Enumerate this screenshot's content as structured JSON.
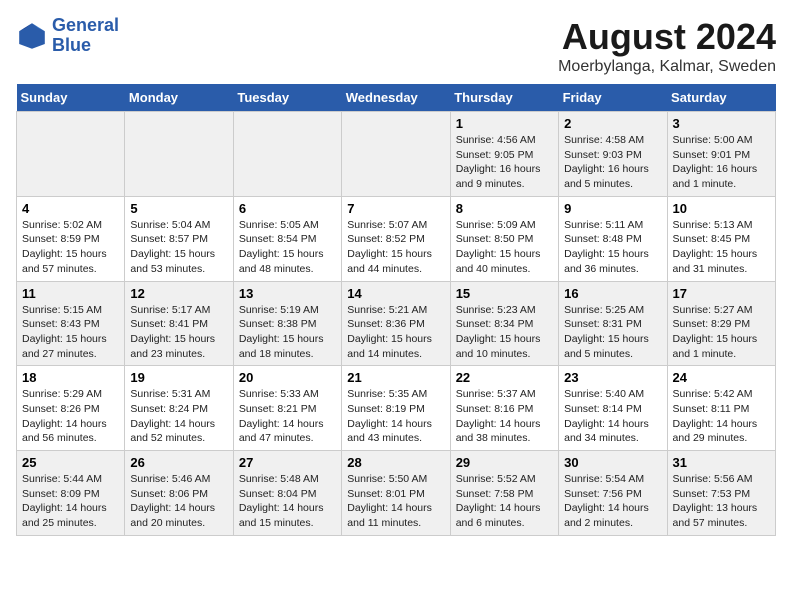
{
  "logo": {
    "text_general": "General",
    "text_blue": "Blue"
  },
  "title": "August 2024",
  "subtitle": "Moerbylanga, Kalmar, Sweden",
  "days_of_week": [
    "Sunday",
    "Monday",
    "Tuesday",
    "Wednesday",
    "Thursday",
    "Friday",
    "Saturday"
  ],
  "weeks": [
    [
      {
        "day": "",
        "info": ""
      },
      {
        "day": "",
        "info": ""
      },
      {
        "day": "",
        "info": ""
      },
      {
        "day": "",
        "info": ""
      },
      {
        "day": "1",
        "info": "Sunrise: 4:56 AM\nSunset: 9:05 PM\nDaylight: 16 hours\nand 9 minutes."
      },
      {
        "day": "2",
        "info": "Sunrise: 4:58 AM\nSunset: 9:03 PM\nDaylight: 16 hours\nand 5 minutes."
      },
      {
        "day": "3",
        "info": "Sunrise: 5:00 AM\nSunset: 9:01 PM\nDaylight: 16 hours\nand 1 minute."
      }
    ],
    [
      {
        "day": "4",
        "info": "Sunrise: 5:02 AM\nSunset: 8:59 PM\nDaylight: 15 hours\nand 57 minutes."
      },
      {
        "day": "5",
        "info": "Sunrise: 5:04 AM\nSunset: 8:57 PM\nDaylight: 15 hours\nand 53 minutes."
      },
      {
        "day": "6",
        "info": "Sunrise: 5:05 AM\nSunset: 8:54 PM\nDaylight: 15 hours\nand 48 minutes."
      },
      {
        "day": "7",
        "info": "Sunrise: 5:07 AM\nSunset: 8:52 PM\nDaylight: 15 hours\nand 44 minutes."
      },
      {
        "day": "8",
        "info": "Sunrise: 5:09 AM\nSunset: 8:50 PM\nDaylight: 15 hours\nand 40 minutes."
      },
      {
        "day": "9",
        "info": "Sunrise: 5:11 AM\nSunset: 8:48 PM\nDaylight: 15 hours\nand 36 minutes."
      },
      {
        "day": "10",
        "info": "Sunrise: 5:13 AM\nSunset: 8:45 PM\nDaylight: 15 hours\nand 31 minutes."
      }
    ],
    [
      {
        "day": "11",
        "info": "Sunrise: 5:15 AM\nSunset: 8:43 PM\nDaylight: 15 hours\nand 27 minutes."
      },
      {
        "day": "12",
        "info": "Sunrise: 5:17 AM\nSunset: 8:41 PM\nDaylight: 15 hours\nand 23 minutes."
      },
      {
        "day": "13",
        "info": "Sunrise: 5:19 AM\nSunset: 8:38 PM\nDaylight: 15 hours\nand 18 minutes."
      },
      {
        "day": "14",
        "info": "Sunrise: 5:21 AM\nSunset: 8:36 PM\nDaylight: 15 hours\nand 14 minutes."
      },
      {
        "day": "15",
        "info": "Sunrise: 5:23 AM\nSunset: 8:34 PM\nDaylight: 15 hours\nand 10 minutes."
      },
      {
        "day": "16",
        "info": "Sunrise: 5:25 AM\nSunset: 8:31 PM\nDaylight: 15 hours\nand 5 minutes."
      },
      {
        "day": "17",
        "info": "Sunrise: 5:27 AM\nSunset: 8:29 PM\nDaylight: 15 hours\nand 1 minute."
      }
    ],
    [
      {
        "day": "18",
        "info": "Sunrise: 5:29 AM\nSunset: 8:26 PM\nDaylight: 14 hours\nand 56 minutes."
      },
      {
        "day": "19",
        "info": "Sunrise: 5:31 AM\nSunset: 8:24 PM\nDaylight: 14 hours\nand 52 minutes."
      },
      {
        "day": "20",
        "info": "Sunrise: 5:33 AM\nSunset: 8:21 PM\nDaylight: 14 hours\nand 47 minutes."
      },
      {
        "day": "21",
        "info": "Sunrise: 5:35 AM\nSunset: 8:19 PM\nDaylight: 14 hours\nand 43 minutes."
      },
      {
        "day": "22",
        "info": "Sunrise: 5:37 AM\nSunset: 8:16 PM\nDaylight: 14 hours\nand 38 minutes."
      },
      {
        "day": "23",
        "info": "Sunrise: 5:40 AM\nSunset: 8:14 PM\nDaylight: 14 hours\nand 34 minutes."
      },
      {
        "day": "24",
        "info": "Sunrise: 5:42 AM\nSunset: 8:11 PM\nDaylight: 14 hours\nand 29 minutes."
      }
    ],
    [
      {
        "day": "25",
        "info": "Sunrise: 5:44 AM\nSunset: 8:09 PM\nDaylight: 14 hours\nand 25 minutes."
      },
      {
        "day": "26",
        "info": "Sunrise: 5:46 AM\nSunset: 8:06 PM\nDaylight: 14 hours\nand 20 minutes."
      },
      {
        "day": "27",
        "info": "Sunrise: 5:48 AM\nSunset: 8:04 PM\nDaylight: 14 hours\nand 15 minutes."
      },
      {
        "day": "28",
        "info": "Sunrise: 5:50 AM\nSunset: 8:01 PM\nDaylight: 14 hours\nand 11 minutes."
      },
      {
        "day": "29",
        "info": "Sunrise: 5:52 AM\nSunset: 7:58 PM\nDaylight: 14 hours\nand 6 minutes."
      },
      {
        "day": "30",
        "info": "Sunrise: 5:54 AM\nSunset: 7:56 PM\nDaylight: 14 hours\nand 2 minutes."
      },
      {
        "day": "31",
        "info": "Sunrise: 5:56 AM\nSunset: 7:53 PM\nDaylight: 13 hours\nand 57 minutes."
      }
    ]
  ]
}
